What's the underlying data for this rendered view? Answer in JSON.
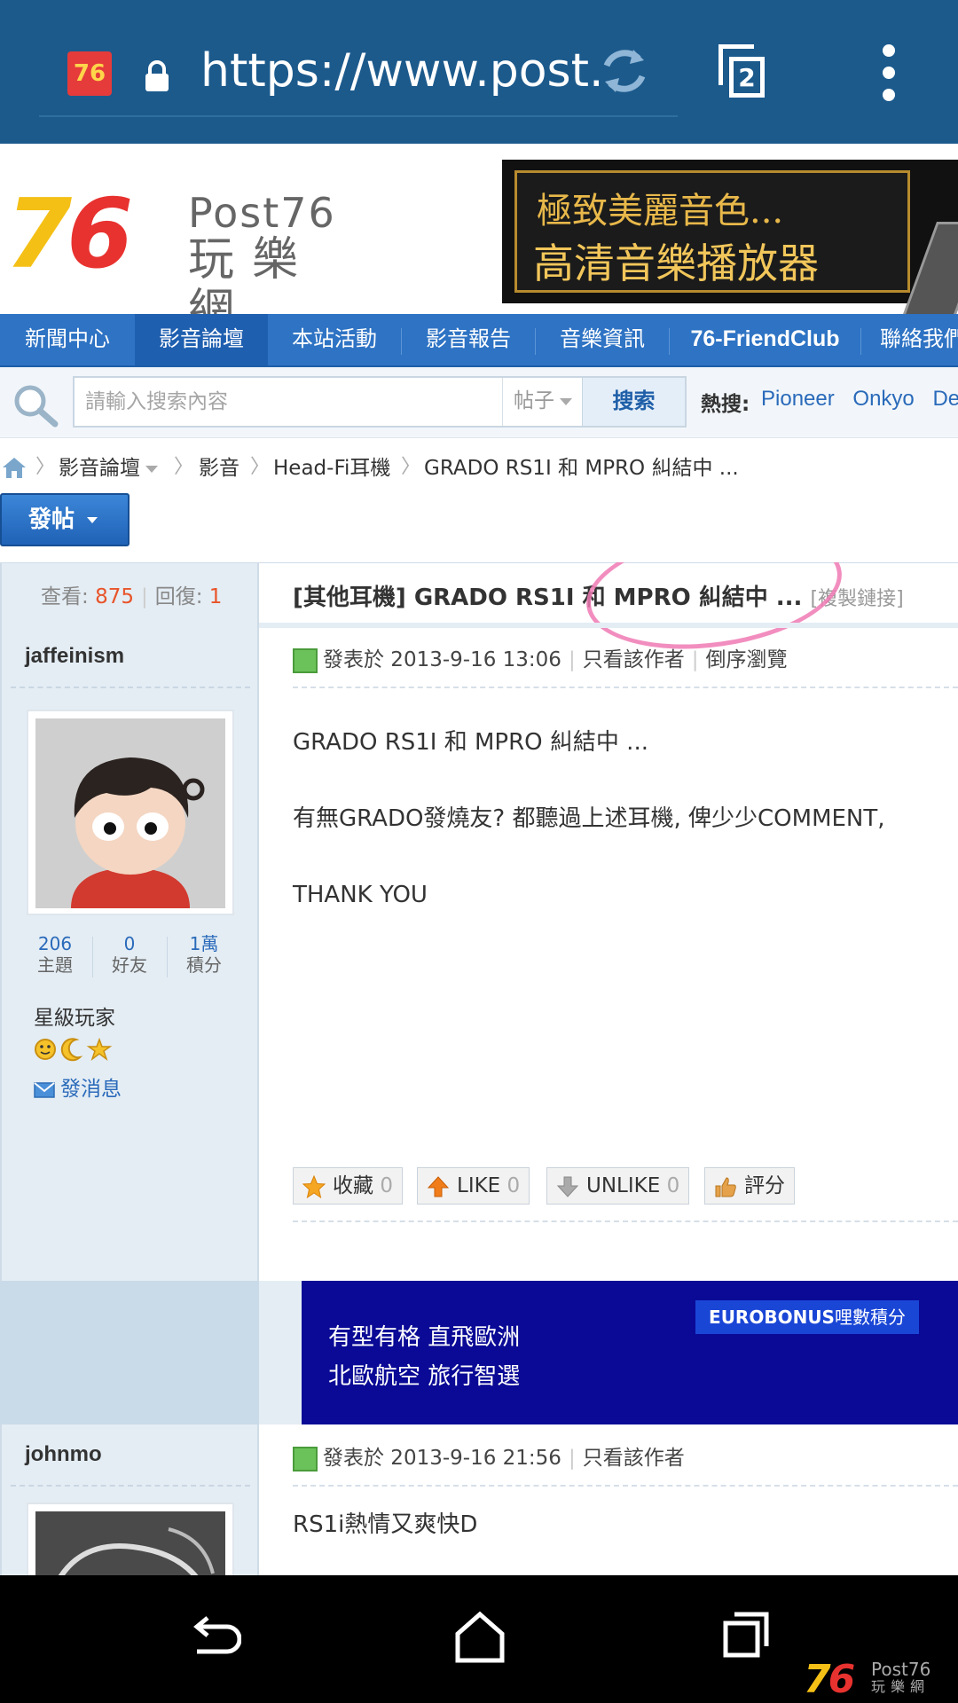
{
  "browser": {
    "favicon_text": "76",
    "url": "https://www.post.",
    "tab_count": "2"
  },
  "header": {
    "logo_number": "76",
    "logo_en": "Post76",
    "logo_cn": "玩樂網",
    "banner_line1": "極致美麗音色...",
    "banner_line2": "高清音樂播放器"
  },
  "nav": {
    "items": [
      "新聞中心",
      "影音論壇",
      "本站活動",
      "影音報告",
      "音樂資訊",
      "76-FriendClub",
      "聯絡我們"
    ],
    "active_index": 1
  },
  "search": {
    "placeholder": "請輸入搜索內容",
    "type": "帖子",
    "button": "搜索",
    "hot_label": "熱搜:",
    "hot_terms": [
      "Pioneer",
      "Onkyo",
      "Denon"
    ]
  },
  "breadcrumb": [
    "影音論壇",
    "影音",
    "Head-Fi耳機",
    "GRADO RS1I 和 MPRO 糾結中 ..."
  ],
  "post_button": "發帖",
  "thread": {
    "views_label": "查看:",
    "views": "875",
    "replies_label": "回復:",
    "replies": "1",
    "title": "[其他耳機] GRADO RS1I 和 MPRO 糾結中 ...",
    "copy_link": "[複製鏈接]"
  },
  "post1": {
    "author": "jaffeinism",
    "stats": [
      {
        "value": "206",
        "label": "主題"
      },
      {
        "value": "0",
        "label": "好友"
      },
      {
        "value": "1萬",
        "label": "積分"
      }
    ],
    "rank": "星級玩家",
    "send_message": "發消息",
    "meta_posted": "發表於 2013-9-16 13:06",
    "meta_author_only": "只看該作者",
    "meta_reverse": "倒序瀏覽",
    "body_lines": [
      "GRADO RS1I 和 MPRO 糾結中 ...",
      "有無GRADO發燒友? 都聽過上述耳機, 俾少少COMMENT,",
      "THANK YOU"
    ],
    "actions": {
      "favorite_label": "收藏",
      "favorite_count": "0",
      "like_label": "LIKE",
      "like_count": "0",
      "unlike_label": "UNLIKE",
      "unlike_count": "0",
      "rate_label": "評分"
    }
  },
  "ad": {
    "line1": "有型有格 直飛歐洲",
    "line2": "北歐航空 旅行智選",
    "badge_bold": "EUROBONUS",
    "badge_rest": "哩數積分"
  },
  "post2": {
    "author": "johnmo",
    "meta_posted": "發表於 2013-9-16 21:56",
    "meta_author_only": "只看該作者",
    "body": "RS1i熱情又爽快D"
  },
  "watermark": {
    "number": "76",
    "en": "Post76",
    "cn": "玩樂網"
  },
  "colors": {
    "browser_bar": "#1c5a8c",
    "nav_bar": "#2e73c4",
    "accent_number": "#e8542a",
    "link_blue": "#2a6aba",
    "annotation_circle": "#f07ab4",
    "ad_background": "#0a0a96"
  }
}
